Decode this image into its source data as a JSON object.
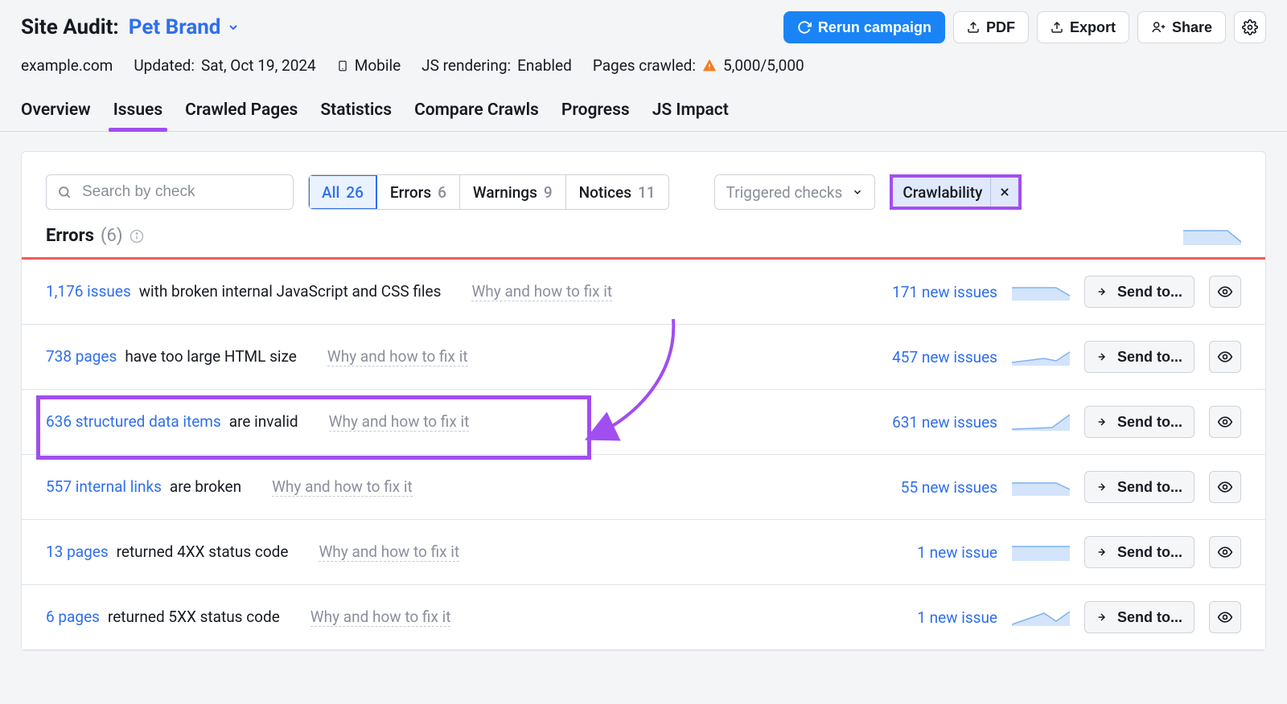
{
  "header": {
    "title": "Site Audit:",
    "project": "Pet Brand",
    "actions": {
      "rerun": "Rerun campaign",
      "pdf": "PDF",
      "export": "Export",
      "share": "Share"
    }
  },
  "meta": {
    "domain": "example.com",
    "updated_label": "Updated:",
    "updated_value": "Sat, Oct 19, 2024",
    "device": "Mobile",
    "js_label": "JS rendering:",
    "js_value": "Enabled",
    "crawled_label": "Pages crawled:",
    "crawled_value": "5,000/5,000"
  },
  "nav": [
    "Overview",
    "Issues",
    "Crawled Pages",
    "Statistics",
    "Compare Crawls",
    "Progress",
    "JS Impact"
  ],
  "nav_active_index": 1,
  "filters": {
    "search_placeholder": "Search by check",
    "segments": [
      {
        "label": "All",
        "count": "26"
      },
      {
        "label": "Errors",
        "count": "6"
      },
      {
        "label": "Warnings",
        "count": "9"
      },
      {
        "label": "Notices",
        "count": "11"
      }
    ],
    "seg_active_index": 0,
    "dropdown": "Triggered checks",
    "tag": "Crawlability"
  },
  "section": {
    "title": "Errors",
    "count": "(6)"
  },
  "rows": [
    {
      "link": "1,176 issues",
      "text": "with broken internal JavaScript and CSS files",
      "hint": "Why and how to fix it",
      "new": "171 new issues",
      "send": "Send to..."
    },
    {
      "link": "738 pages",
      "text": "have too large HTML size",
      "hint": "Why and how to fix it",
      "new": "457 new issues",
      "send": "Send to..."
    },
    {
      "link": "636 structured data items",
      "text": "are invalid",
      "hint": "Why and how to fix it",
      "new": "631 new issues",
      "send": "Send to..."
    },
    {
      "link": "557 internal links",
      "text": "are broken",
      "hint": "Why and how to fix it",
      "new": "55 new issues",
      "send": "Send to..."
    },
    {
      "link": "13 pages",
      "text": "returned 4XX status code",
      "hint": "Why and how to fix it",
      "new": "1 new issue",
      "send": "Send to..."
    },
    {
      "link": "6 pages",
      "text": "returned 5XX status code",
      "hint": "Why and how to fix it",
      "new": "1 new issue",
      "send": "Send to..."
    }
  ]
}
